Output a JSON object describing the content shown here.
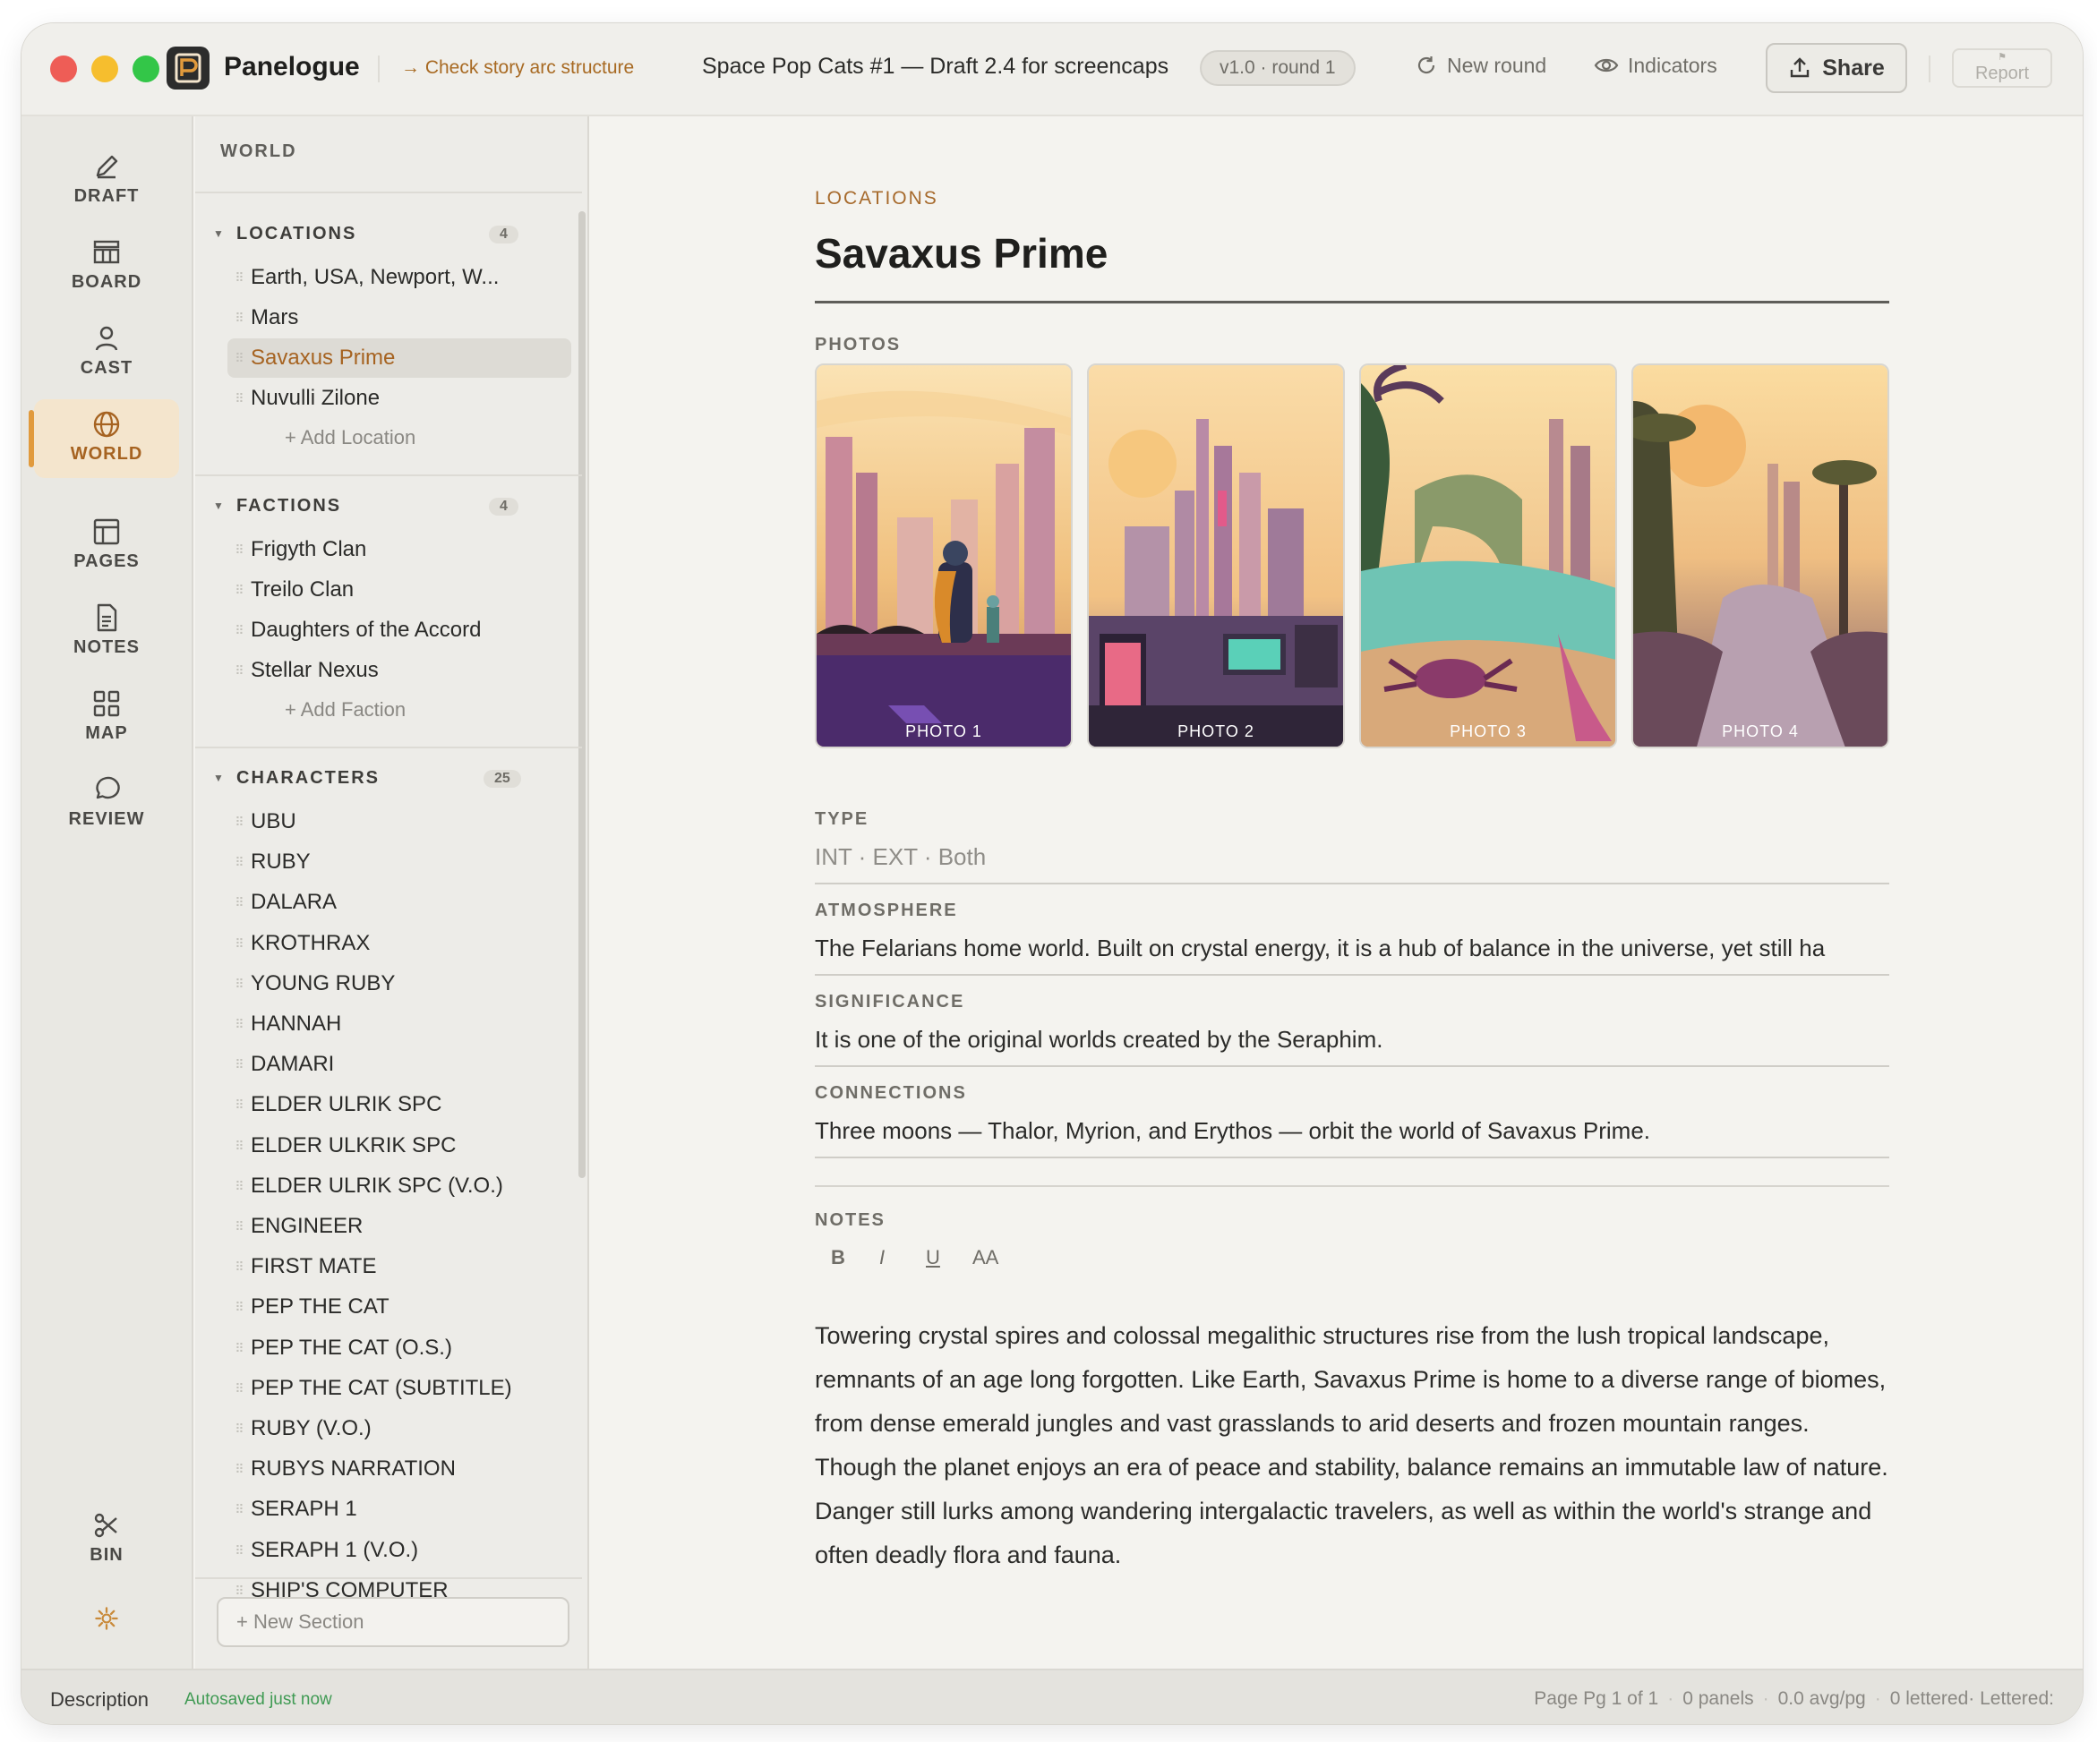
{
  "app": {
    "name": "Panelogue",
    "story_arc_link": "→ Check story arc structure",
    "document_title": "Space Pop Cats #1 — Draft 2.4 for screencaps",
    "version_badge": "v1.0 · round 1",
    "new_round_label": "New round",
    "indicators_label": "Indicators",
    "share_label": "Share",
    "report_label": "Report"
  },
  "rail": {
    "items": [
      {
        "label": "DRAFT",
        "icon": "pencil-icon"
      },
      {
        "label": "BOARD",
        "icon": "board-icon"
      },
      {
        "label": "CAST",
        "icon": "person-icon"
      },
      {
        "label": "WORLD",
        "icon": "globe-icon",
        "active": true
      },
      {
        "label": "PAGES",
        "icon": "layout-icon"
      },
      {
        "label": "NOTES",
        "icon": "document-icon"
      },
      {
        "label": "MAP",
        "icon": "grid-icon"
      },
      {
        "label": "REVIEW",
        "icon": "chat-bubble-icon"
      }
    ],
    "bin_label": "BIN",
    "settings_icon": "gear-icon"
  },
  "sidebar": {
    "title": "WORLD",
    "sections": [
      {
        "title": "LOCATIONS",
        "count": "4",
        "items": [
          "Earth, USA, Newport, W...",
          "Mars",
          "Savaxus Prime",
          "Nuvulli Zilone"
        ],
        "selected_index": 2,
        "add_label": "+ Add Location"
      },
      {
        "title": "FACTIONS",
        "count": "4",
        "items": [
          "Frigyth Clan",
          "Treilo Clan",
          "Daughters of the Accord",
          "Stellar Nexus"
        ],
        "add_label": "+ Add Faction"
      },
      {
        "title": "CHARACTERS",
        "count": "25",
        "items": [
          "UBU",
          "RUBY",
          "DALARA",
          "KROTHRAX",
          "YOUNG RUBY",
          "HANNAH",
          "DAMARI",
          "ELDER ULRIK SPC",
          "ELDER ULKRIK SPC",
          "ELDER ULRIK SPC (V.O.)",
          "ENGINEER",
          "FIRST MATE",
          "PEP THE CAT",
          "PEP THE CAT (O.S.)",
          "PEP THE CAT (SUBTITLE)",
          "RUBY (V.O.)",
          "RUBYS NARRATION",
          "SERAPH 1",
          "SERAPH 1 (V.O.)",
          "SHIP'S COMPUTER"
        ]
      }
    ],
    "new_section_label": "+ New Section"
  },
  "main": {
    "eyebrow": "LOCATIONS",
    "title": "Savaxus Prime",
    "photos_label": "PHOTOS",
    "photos": [
      {
        "caption": "PHOTO 1"
      },
      {
        "caption": "PHOTO 2"
      },
      {
        "caption": "PHOTO 3"
      },
      {
        "caption": "PHOTO 4"
      }
    ],
    "fields": {
      "type_label": "TYPE",
      "type_value": "INT · EXT · Both",
      "atmosphere_label": "ATMOSPHERE",
      "atmosphere_value": "The Felarians home world. Built on crystal energy, it is a hub of balance in the universe, yet still ha",
      "significance_label": "SIGNIFICANCE",
      "significance_value": "It is one of the original worlds created by the Seraphim.",
      "connections_label": "CONNECTIONS",
      "connections_value": "Three moons — Thalor, Myrion, and Erythos — orbit the world of Savaxus Prime."
    },
    "notes_label": "NOTES",
    "format_buttons": {
      "bold": "B",
      "italic": "I",
      "underline": "U",
      "size": "AA"
    },
    "notes_paragraphs": [
      "Towering crystal spires and colossal megalithic structures rise from the lush tropical landscape, remnants of an age long forgotten. Like Earth, Savaxus Prime is home to a diverse range of biomes, from dense emerald jungles and vast grasslands to arid deserts and frozen mountain ranges.",
      "Though the planet enjoys an era of peace and stability, balance remains an immutable law of nature. Danger still lurks among wandering intergalactic travelers, as well as within the world's strange and often deadly flora and fauna."
    ]
  },
  "status": {
    "mode": "Description",
    "autosave": "Autosaved just now",
    "page": "Page Pg 1 of 1",
    "panels": "0 panels",
    "avg": "0.0 avg/pg",
    "lettered": "0 lettered· Lettered:"
  },
  "colors": {
    "accent": "#a66321",
    "accent_bg": "#f4e5cd",
    "autosave_green": "#3f9a53"
  }
}
